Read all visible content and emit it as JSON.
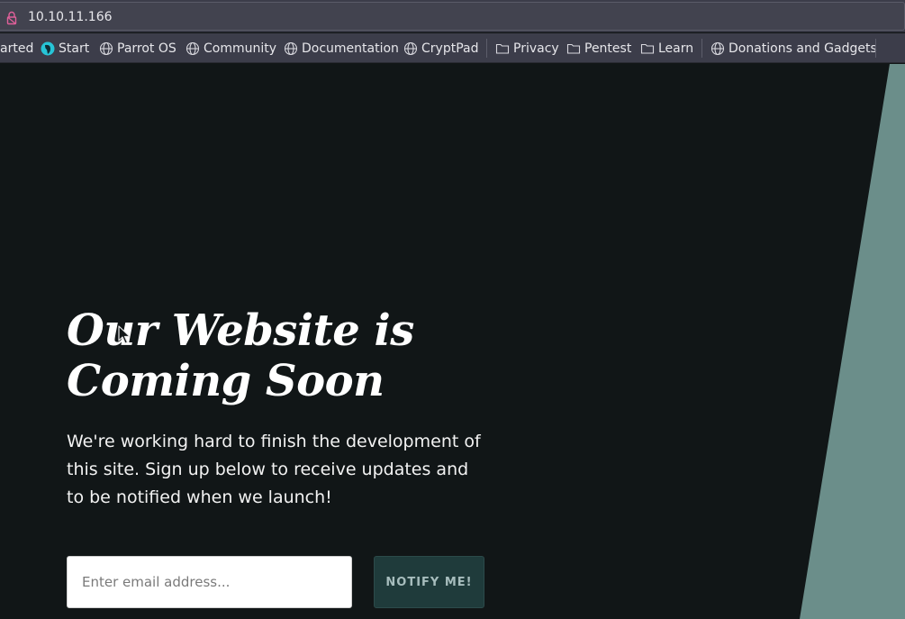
{
  "browser": {
    "url": "10.10.11.166",
    "bookmarks": [
      {
        "label": "arted",
        "icon": "none"
      },
      {
        "label": "Start",
        "icon": "parrot-icon"
      },
      {
        "label": "Parrot OS",
        "icon": "globe-icon"
      },
      {
        "label": "Community",
        "icon": "globe-icon"
      },
      {
        "label": "Documentation",
        "icon": "globe-icon"
      },
      {
        "label": "CryptPad",
        "icon": "globe-icon"
      },
      {
        "label": "Privacy",
        "icon": "folder-icon"
      },
      {
        "label": "Pentest",
        "icon": "folder-icon"
      },
      {
        "label": "Learn",
        "icon": "folder-icon"
      },
      {
        "label": "Donations and Gadgets",
        "icon": "globe-icon"
      }
    ]
  },
  "hero": {
    "title_line1": "Our Website is",
    "title_line2": "Coming Soon",
    "text": "We're working hard to finish the development of this site. Sign up below to receive updates and to be notified when we launch!"
  },
  "signup": {
    "placeholder": "Enter email address...",
    "button_label": "NOTIFY ME!"
  },
  "colors": {
    "background": "#111617",
    "accent_panel": "#6b8e8a",
    "button_bg": "#1f3b3b",
    "button_text": "#a7bdbd"
  }
}
